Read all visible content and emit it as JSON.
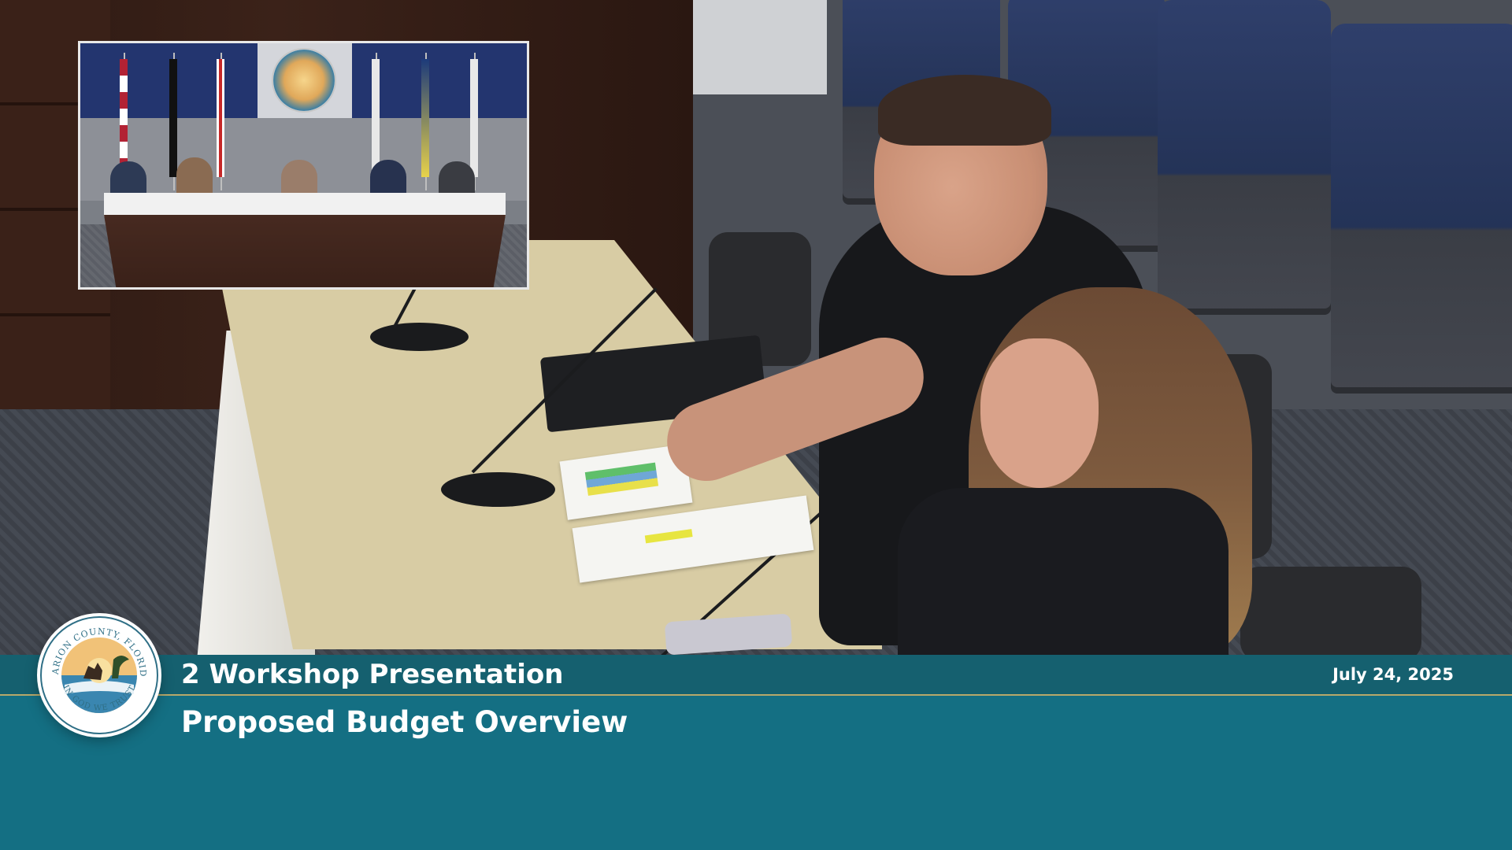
{
  "broadcast": {
    "agenda_item": "2 Workshop Presentation",
    "subtitle": "Proposed Budget Overview",
    "date": "July 24, 2025"
  },
  "seal": {
    "top_text": "MARION COUNTY, FLORIDA",
    "bottom_text": "IN GOD WE TRUST",
    "icon": "county-seal-icon"
  },
  "colors": {
    "banner_teal": "#146f83",
    "banner_dark_teal": "#15606f",
    "divider_gold": "#b8a86a",
    "text_white": "#ffffff"
  }
}
